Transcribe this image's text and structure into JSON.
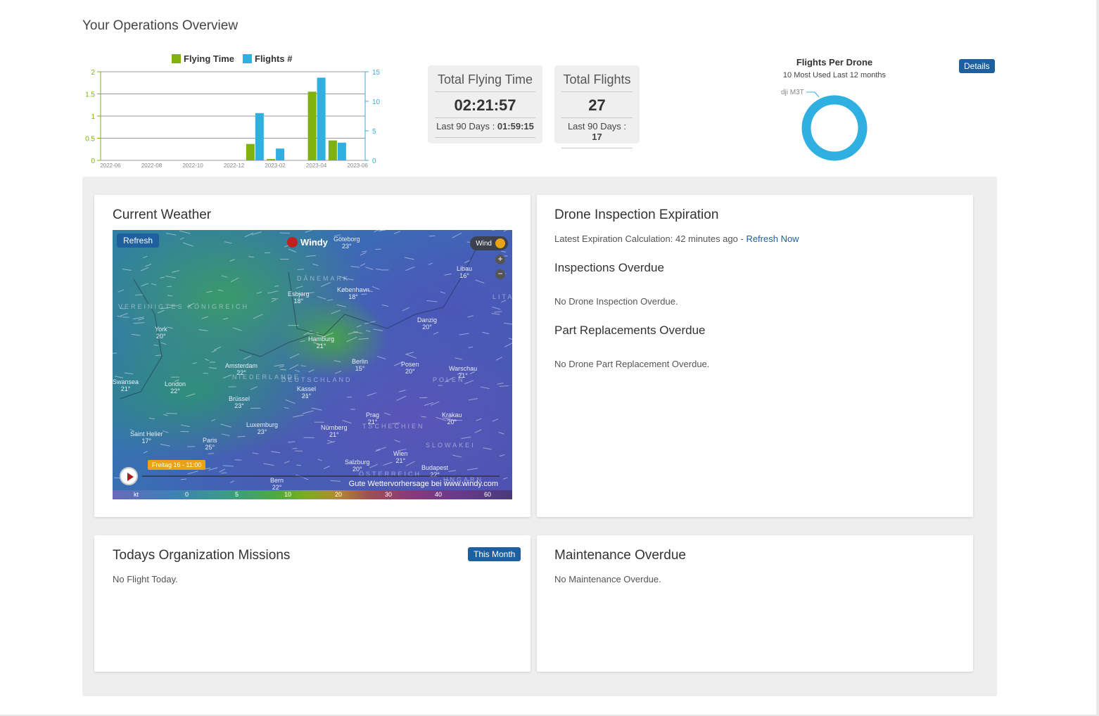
{
  "page": {
    "title": "Your Operations Overview"
  },
  "chart_data": {
    "type": "bar",
    "categories": [
      "2022-06",
      "2022-07",
      "2022-08",
      "2022-09",
      "2022-10",
      "2022-11",
      "2022-12",
      "2023-01",
      "2023-02",
      "2023-03",
      "2023-04",
      "2023-05",
      "2023-06"
    ],
    "x_tick_labels": [
      "2022-06",
      "2022-08",
      "2022-10",
      "2022-12",
      "2023-02",
      "2023-04",
      "2023-06"
    ],
    "series": [
      {
        "name": "Flying Time",
        "axis": "left",
        "color": "#7fb20f",
        "values": [
          0,
          0,
          0,
          0,
          0,
          0,
          0,
          0.37,
          0.03,
          0,
          1.55,
          0.45,
          0
        ]
      },
      {
        "name": "Flights #",
        "axis": "right",
        "color": "#2fb0e0",
        "values": [
          0,
          0,
          0,
          0,
          0,
          0,
          0,
          8,
          2,
          0,
          14,
          3,
          0
        ]
      }
    ],
    "ylim_left": [
      0,
      2
    ],
    "yticks_left": [
      "0",
      "0.5",
      "1",
      "1.5",
      "2"
    ],
    "ylim_right": [
      0,
      15
    ],
    "yticks_right": [
      "0",
      "5",
      "10",
      "15"
    ],
    "legend_position": "top",
    "grid": true
  },
  "stats": {
    "flying_time": {
      "label": "Total Flying Time",
      "value": "02:21:57",
      "sub_label": "Last 90 Days : ",
      "sub_value": "01:59:15"
    },
    "flights": {
      "label": "Total Flights",
      "value": "27",
      "sub_label": "Last 90 Days : ",
      "sub_value": "17"
    }
  },
  "donut": {
    "title": "Flights Per Drone",
    "subtitle": "10 Most Used Last 12 months",
    "details_label": "Details",
    "slices": [
      {
        "label": "dji M3T",
        "value": 27,
        "color": "#2fb0e0"
      }
    ]
  },
  "weather": {
    "title": "Current Weather",
    "refresh_label": "Refresh",
    "brand": "Windy",
    "layer_label": "Wind",
    "time_label": "Freitag 16 - 11:00",
    "credit": "Gute Wettervorhersage bei www.windy.com",
    "scale_unit": "kt",
    "scale_values": [
      "0",
      "5",
      "10",
      "20",
      "30",
      "40",
      "60"
    ],
    "cities": [
      {
        "name": "Göteborg",
        "temp": "23°"
      },
      {
        "name": "Esbjerg",
        "temp": "18°"
      },
      {
        "name": "København",
        "temp": "18°"
      },
      {
        "name": "Libau",
        "temp": "16°"
      },
      {
        "name": "Danzig",
        "temp": "20°"
      },
      {
        "name": "York",
        "temp": "20°"
      },
      {
        "name": "Hamburg",
        "temp": "21°"
      },
      {
        "name": "Amsterdam",
        "temp": "22°"
      },
      {
        "name": "Berlin",
        "temp": "15°"
      },
      {
        "name": "Posen",
        "temp": "20°"
      },
      {
        "name": "Warschau",
        "temp": "21°"
      },
      {
        "name": "London",
        "temp": "22°"
      },
      {
        "name": "Kassel",
        "temp": "21°"
      },
      {
        "name": "Brüssel",
        "temp": "23°"
      },
      {
        "name": "Swansea",
        "temp": "21°"
      },
      {
        "name": "Luxemburg",
        "temp": "23°"
      },
      {
        "name": "Prag",
        "temp": "21°"
      },
      {
        "name": "Krakau",
        "temp": "20°"
      },
      {
        "name": "Nürnberg",
        "temp": "21°"
      },
      {
        "name": "Saint Helier",
        "temp": "17°"
      },
      {
        "name": "Paris",
        "temp": "25°"
      },
      {
        "name": "Wien",
        "temp": "21°"
      },
      {
        "name": "Salzburg",
        "temp": "20°"
      },
      {
        "name": "Budapest",
        "temp": "22°"
      },
      {
        "name": "Bern",
        "temp": "22°"
      }
    ],
    "countries": [
      "DÄNEMARK",
      "VEREINIGTES KÖNIGREICH",
      "NIEDERLANDE",
      "DEUTSCHLAND",
      "POLEN",
      "TSCHECHIEN",
      "SLOWAKEI",
      "LITAUEN",
      "ÖSTERREICH",
      "UNGARN"
    ]
  },
  "inspection": {
    "title": "Drone Inspection Expiration",
    "calc_text": "Latest Expiration Calculation: 42 minutes ago - ",
    "refresh_link": "Refresh Now",
    "overdue_title": "Inspections Overdue",
    "overdue_text": "No Drone Inspection Overdue.",
    "parts_title": "Part Replacements Overdue",
    "parts_text": "No Drone Part Replacement Overdue."
  },
  "missions": {
    "title": "Todays Organization Missions",
    "button_label": "This Month",
    "empty_text": "No Flight Today."
  },
  "maintenance": {
    "title": "Maintenance Overdue",
    "empty_text": "No Maintenance Overdue."
  }
}
